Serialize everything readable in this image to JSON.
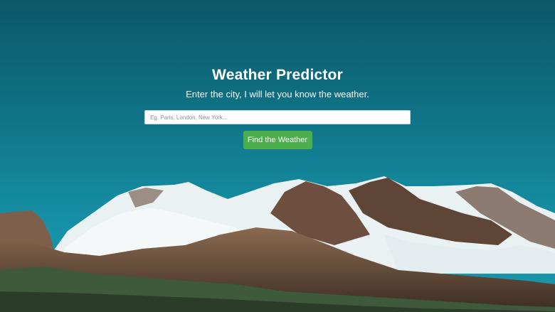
{
  "header": {
    "title": "Weather Predictor",
    "subtitle": "Enter the city, I will let you know the weather."
  },
  "search": {
    "placeholder": "Eg. Paris, London, New York...",
    "value": ""
  },
  "actions": {
    "find_label": "Find the Weather"
  },
  "colors": {
    "sky_top": "#0b5869",
    "sky_bottom": "#1b95aa",
    "button": "#4cae4c",
    "snow": "#eef4f6",
    "rock": "#6b4f3f"
  }
}
